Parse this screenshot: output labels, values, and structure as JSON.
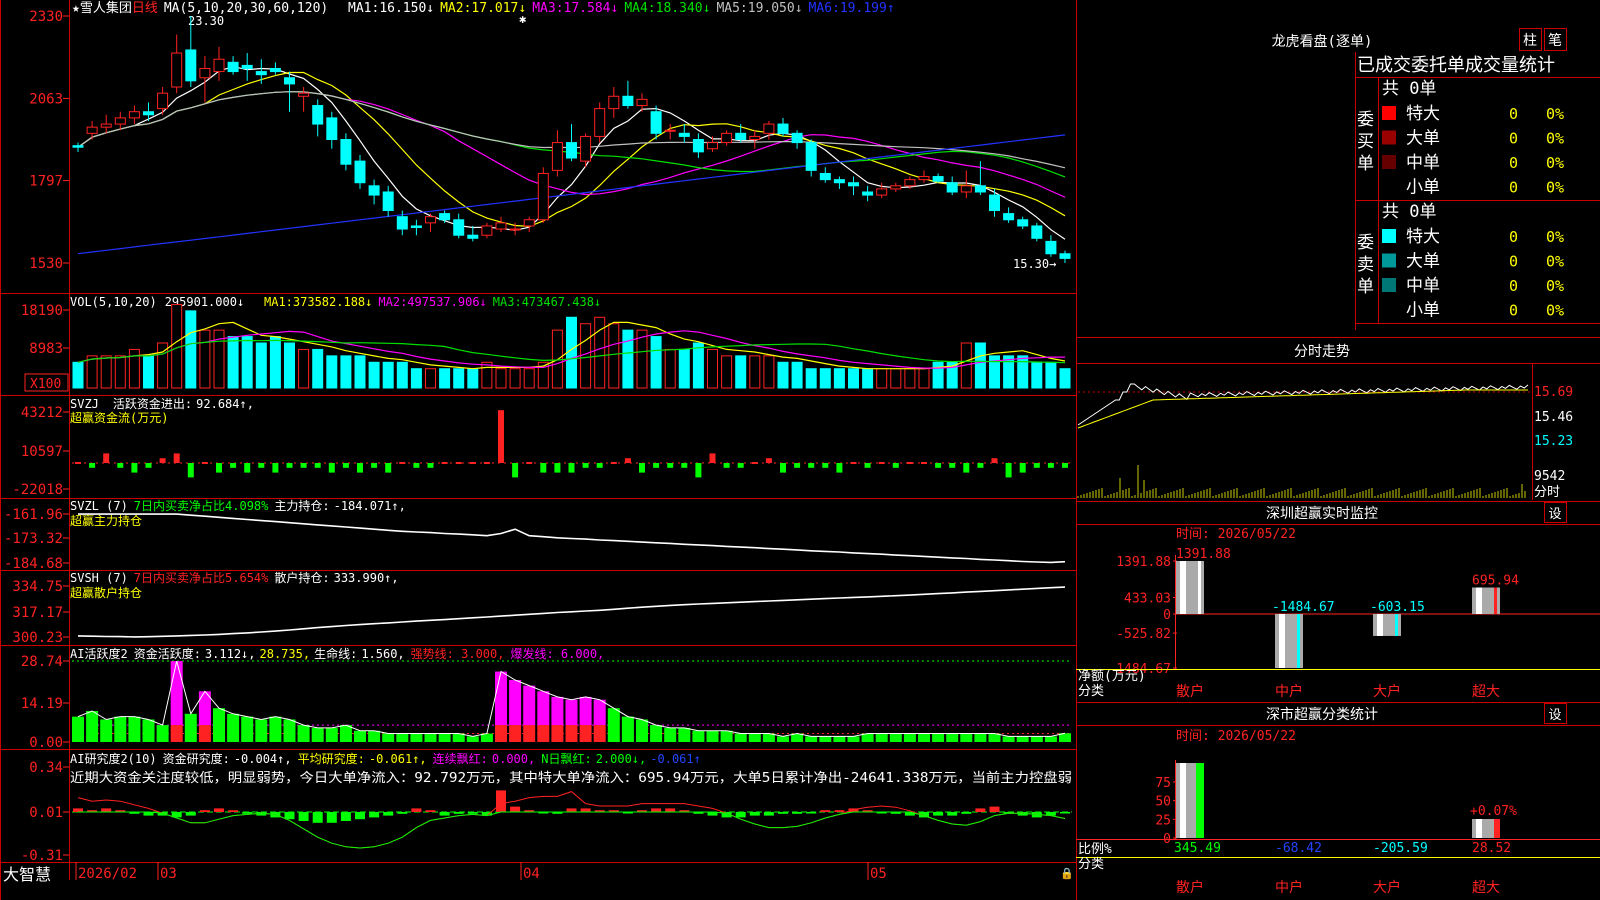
{
  "colors": {
    "up": "#ff2222",
    "down": "#00ffff",
    "grid": "#cc0000",
    "ma1": "#ffffff",
    "ma2": "#ffff00",
    "ma3": "#ff00ff",
    "ma4": "#00e000",
    "ma5": "#c0c0c0",
    "ma6": "#2233ff"
  },
  "main": {
    "stock_name": "雪人集团",
    "period": "日线",
    "ma_header": "MA(5,10,20,30,60,120)",
    "ma_items": [
      {
        "label": "MA1:",
        "value": "16.150↓",
        "color": "#ffffff"
      },
      {
        "label": "MA2:",
        "value": "17.017↓",
        "color": "#ffff00"
      },
      {
        "label": "MA3:",
        "value": "17.584↓",
        "color": "#ff00ff"
      },
      {
        "label": "MA4:",
        "value": "18.340↓",
        "color": "#00e000"
      },
      {
        "label": "MA5:",
        "value": "19.050↓",
        "color": "#c0c0c0"
      },
      {
        "label": "MA6:",
        "value": "19.199↑",
        "color": "#2233ff"
      }
    ],
    "y_ticks": [
      "2330",
      "2063",
      "1797",
      "1530"
    ],
    "high_label": "23.30",
    "low_label": "15.30→"
  },
  "vol": {
    "header": "VOL(5,10,20)",
    "value": "295901.000↓",
    "items": [
      {
        "label": "MA1:",
        "value": "373582.188↓",
        "color": "#ffff00"
      },
      {
        "label": "MA2:",
        "value": "497537.906↓",
        "color": "#ff00ff"
      },
      {
        "label": "MA3:",
        "value": "473467.438↓",
        "color": "#00e000"
      }
    ],
    "y_ticks": [
      "18190",
      "8983"
    ],
    "unit": "X100"
  },
  "svzj": {
    "header": "SVZJ",
    "line1": "活跃资金进出:",
    "value": "92.684↑,",
    "line2": "超赢资金流(万元)",
    "y_ticks": [
      "43212",
      "10597",
      "-22018"
    ]
  },
  "svzl": {
    "header": "SVZL (7)",
    "t1": "7日内买卖净占比4.098%",
    "t2": "主力持仓:",
    "value": "-184.071↑,",
    "line2": "超赢主力持仓",
    "y_ticks": [
      "-161.96",
      "-173.32",
      "-184.68"
    ]
  },
  "svsh": {
    "header": "SVSH (7)",
    "t1": "7日内买卖净占比5.654%",
    "t2": "散户持仓:",
    "value": "333.990↑,",
    "line2": "超赢散户持仓",
    "y_ticks": [
      "334.75",
      "317.17",
      "300.23"
    ]
  },
  "ai1": {
    "header": "AI活跃度2",
    "t1": "资金活跃度:",
    "v1": "3.112↓,",
    "v2": "28.735,",
    "t3": "生命线:",
    "v3": "1.560,",
    "t4": "强势线: 3.000,",
    "t5": "爆发线: 6.000,",
    "y_ticks": [
      "28.74",
      "14.19",
      "0.00"
    ]
  },
  "ai2": {
    "header": "AI研究度2(10)",
    "t1": "资金研究度:",
    "v1": "-0.004↑,",
    "t2": "平均研究度:",
    "v2": "-0.061↑,",
    "t3": "连续飘红:",
    "v3": "0.000,",
    "t4": "N日飘红:",
    "v4": "2.000↓,",
    "v5": "-0.061↑",
    "comment": "近期大资金关注度较低，明显弱势，今日大单净流入：92.792万元，其中特大单净流入：695.94万元，大单5日累计净出-24641.338万元，当前主力控盘弱",
    "y_ticks": [
      "0.34",
      "0.01",
      "-0.31"
    ]
  },
  "x_axis": {
    "labels": [
      "2026/02",
      "03",
      "04",
      "05"
    ],
    "brand": "大智慧"
  },
  "dragon": {
    "title": "龙虎看盘(逐单)",
    "btn1": "柱",
    "btn2": "笔",
    "subtitle": "已成交委托单成交量统计",
    "buy": {
      "label": "委买单",
      "total": "共 0单",
      "rows": [
        {
          "name": "特大",
          "val": "0",
          "pct": "0%",
          "color": "#ff0000"
        },
        {
          "name": "大单",
          "val": "0",
          "pct": "0%",
          "color": "#990000"
        },
        {
          "name": "中单",
          "val": "0",
          "pct": "0%",
          "color": "#660000"
        },
        {
          "name": "小单",
          "val": "0",
          "pct": "0%",
          "color": "#000000"
        }
      ]
    },
    "sell": {
      "label": "委卖单",
      "total": "共 0单",
      "rows": [
        {
          "name": "特大",
          "val": "0",
          "pct": "0%",
          "color": "#00ffff"
        },
        {
          "name": "大单",
          "val": "0",
          "pct": "0%",
          "color": "#009999"
        },
        {
          "name": "中单",
          "val": "0",
          "pct": "0%",
          "color": "#007777"
        },
        {
          "name": "小单",
          "val": "0",
          "pct": "0%",
          "color": "#000000"
        }
      ]
    }
  },
  "intraday": {
    "title": "分时走势",
    "price_ticks": [
      "15.69",
      "15.46",
      "15.23"
    ],
    "vol_tick": "9542",
    "unit": "分时"
  },
  "monitor": {
    "title": "深圳超赢实时监控",
    "btn": "设",
    "time": "时间: 2026/05/22",
    "y_ticks": [
      "1391.88",
      "433.03",
      "0",
      "-525.82",
      "-1484.67"
    ],
    "ylabel1": "净额(万元)",
    "ylabel2": "分类",
    "categories": [
      "散户",
      "中户",
      "大户",
      "超大"
    ],
    "values": [
      1391.88,
      -1484.67,
      -603.15,
      695.94
    ],
    "value_labels": [
      "1391.88",
      "-1484.67",
      "-603.15",
      "695.94"
    ]
  },
  "classify": {
    "title": "深市超赢分类统计",
    "btn": "设",
    "time": "时间: 2026/05/22",
    "y_ticks": [
      "75",
      "50",
      "25",
      "0"
    ],
    "ylabel1": "比例%",
    "ylabel2": "分类",
    "pct_label": "+0.07%",
    "categories": [
      "散户",
      "中户",
      "大户",
      "超大"
    ],
    "values": [
      345.49,
      -68.42,
      -205.59,
      28.52
    ],
    "value_labels": [
      "345.49",
      "-68.42",
      "-205.59",
      "28.52"
    ]
  },
  "chart_data": [
    {
      "type": "candlestick",
      "title": "雪人集团 日线",
      "ylim": [
        15.3,
        23.3
      ],
      "candles": [
        [
          19.1,
          19.2,
          18.9,
          19.05
        ],
        [
          19.5,
          19.9,
          19.3,
          19.7
        ],
        [
          19.7,
          20.1,
          19.5,
          19.8
        ],
        [
          19.8,
          20.2,
          19.6,
          20.0
        ],
        [
          20.0,
          20.4,
          19.8,
          20.2
        ],
        [
          20.2,
          20.5,
          19.9,
          20.1
        ],
        [
          20.3,
          21.0,
          20.1,
          20.8
        ],
        [
          21.0,
          22.7,
          20.8,
          22.1
        ],
        [
          22.2,
          23.3,
          21.0,
          21.2
        ],
        [
          21.3,
          22.0,
          20.5,
          21.6
        ],
        [
          21.5,
          22.3,
          21.2,
          21.9
        ],
        [
          21.8,
          22.0,
          21.4,
          21.5
        ],
        [
          21.7,
          22.1,
          21.2,
          21.6
        ],
        [
          21.5,
          21.9,
          21.1,
          21.4
        ],
        [
          21.6,
          21.8,
          21.4,
          21.5
        ],
        [
          21.3,
          21.5,
          20.2,
          21.1
        ],
        [
          20.7,
          21.0,
          20.2,
          20.8
        ],
        [
          20.4,
          20.6,
          19.4,
          19.8
        ],
        [
          20.0,
          20.2,
          19.0,
          19.3
        ],
        [
          19.3,
          19.5,
          18.3,
          18.5
        ],
        [
          18.6,
          18.8,
          17.7,
          17.9
        ],
        [
          17.8,
          18.0,
          17.2,
          17.5
        ],
        [
          17.6,
          17.8,
          16.8,
          17.0
        ],
        [
          16.8,
          17.0,
          16.2,
          16.4
        ],
        [
          16.5,
          16.7,
          16.2,
          16.45
        ],
        [
          16.6,
          16.9,
          16.3,
          16.8
        ],
        [
          16.9,
          17.0,
          16.6,
          16.7
        ],
        [
          16.7,
          16.9,
          16.1,
          16.2
        ],
        [
          16.2,
          16.5,
          16.0,
          16.1
        ],
        [
          16.2,
          16.6,
          16.1,
          16.5
        ],
        [
          16.4,
          16.8,
          16.3,
          16.6
        ],
        [
          16.4,
          16.6,
          16.2,
          16.4
        ],
        [
          16.5,
          16.8,
          16.3,
          16.7
        ],
        [
          16.7,
          18.4,
          16.6,
          18.2
        ],
        [
          18.3,
          19.6,
          18.1,
          19.2
        ],
        [
          19.2,
          19.8,
          18.6,
          18.7
        ],
        [
          18.6,
          19.5,
          18.4,
          19.4
        ],
        [
          19.4,
          20.5,
          19.2,
          20.3
        ],
        [
          20.3,
          21.0,
          20.0,
          20.7
        ],
        [
          20.7,
          21.2,
          20.3,
          20.4
        ],
        [
          20.4,
          20.8,
          20.2,
          20.6
        ],
        [
          20.2,
          20.4,
          19.3,
          19.5
        ],
        [
          19.6,
          19.8,
          19.3,
          19.6
        ],
        [
          19.5,
          19.8,
          19.2,
          19.4
        ],
        [
          19.3,
          19.5,
          18.7,
          18.9
        ],
        [
          19.0,
          19.4,
          18.9,
          19.2
        ],
        [
          19.2,
          19.6,
          19.1,
          19.5
        ],
        [
          19.5,
          19.8,
          19.2,
          19.3
        ],
        [
          19.3,
          19.6,
          19.0,
          19.4
        ],
        [
          19.5,
          19.9,
          19.3,
          19.8
        ],
        [
          19.8,
          20.0,
          19.4,
          19.5
        ],
        [
          19.5,
          19.6,
          19.0,
          19.2
        ],
        [
          19.2,
          19.3,
          18.1,
          18.3
        ],
        [
          18.2,
          18.4,
          17.9,
          18.0
        ],
        [
          18.0,
          18.1,
          17.7,
          17.9
        ],
        [
          17.9,
          18.1,
          17.5,
          17.8
        ],
        [
          17.6,
          17.8,
          17.3,
          17.5
        ],
        [
          17.5,
          17.9,
          17.4,
          17.7
        ],
        [
          17.7,
          17.9,
          17.6,
          17.8
        ],
        [
          17.8,
          18.1,
          17.7,
          18.0
        ],
        [
          18.0,
          18.3,
          17.9,
          18.1
        ],
        [
          18.1,
          18.2,
          17.9,
          17.95
        ],
        [
          17.9,
          18.1,
          17.5,
          17.6
        ],
        [
          17.6,
          18.3,
          17.4,
          17.8
        ],
        [
          17.8,
          18.6,
          17.5,
          17.6
        ],
        [
          17.5,
          17.7,
          16.8,
          17.0
        ],
        [
          16.9,
          17.1,
          16.6,
          16.7
        ],
        [
          16.7,
          16.8,
          16.4,
          16.5
        ],
        [
          16.5,
          16.6,
          16.0,
          16.1
        ],
        [
          16.0,
          16.2,
          15.5,
          15.6
        ],
        [
          15.6,
          15.7,
          15.3,
          15.45
        ]
      ]
    },
    {
      "type": "bar",
      "title": "VOL(5,10,20)",
      "values": [
        4,
        5,
        5,
        5,
        6,
        5,
        7,
        13,
        12,
        9,
        9,
        8,
        8,
        7,
        8,
        7,
        6,
        6,
        5,
        5,
        5,
        4,
        4,
        4,
        3,
        3,
        3,
        3,
        3,
        4,
        3,
        3,
        3,
        4,
        9,
        11,
        10,
        11,
        10,
        9,
        9,
        8,
        6,
        6,
        7,
        6,
        5,
        5,
        5,
        5,
        4,
        4,
        3,
        3,
        3,
        3,
        3,
        3,
        3,
        3,
        3,
        4,
        4,
        7,
        7,
        5,
        5,
        5,
        4,
        4,
        3
      ]
    },
    {
      "type": "bar",
      "title": "超赢资金流(万元)",
      "values": [
        0,
        -1,
        2,
        -1,
        -2,
        -1,
        1,
        2,
        -3,
        0,
        -2,
        -1,
        -2,
        -1,
        -2,
        -1,
        -1,
        -1,
        -2,
        -1,
        -2,
        -1,
        -2,
        0,
        -1,
        -1,
        0,
        0,
        0,
        0,
        11,
        -3,
        0,
        -2,
        -2,
        -2,
        -1,
        -1,
        0,
        1,
        -2,
        -1,
        -1,
        -1,
        -3,
        2,
        -1,
        -1,
        0,
        1,
        -2,
        -1,
        -1,
        -1,
        -2,
        0,
        -1,
        0,
        -1,
        0,
        0,
        -1,
        -1,
        -2,
        -1,
        1,
        -3,
        -2,
        -1,
        -1,
        -1
      ]
    },
    {
      "type": "line",
      "title": "超赢主力持仓",
      "values": [
        -162,
        -162,
        -162,
        -162,
        -162,
        -162,
        -162,
        -162,
        -162.5,
        -163,
        -163.5,
        -164,
        -164.5,
        -165,
        -165.5,
        -166,
        -166.5,
        -167,
        -167.5,
        -168,
        -168.5,
        -169,
        -169.5,
        -170,
        -170.3,
        -170.6,
        -171,
        -171.3,
        -171.6,
        -172,
        -171,
        -169,
        -172,
        -172.5,
        -173,
        -173.3,
        -173.6,
        -174,
        -174.3,
        -174.6,
        -175,
        -175.3,
        -175.6,
        -176,
        -176.3,
        -176.6,
        -177,
        -177.3,
        -177.6,
        -178,
        -178.3,
        -178.6,
        -179,
        -179.3,
        -179.6,
        -180,
        -180.3,
        -180.6,
        -181,
        -181.3,
        -181.6,
        -182,
        -182.3,
        -182.6,
        -183,
        -183.3,
        -183.6,
        -184,
        -184.2,
        -184.4,
        -184.07
      ]
    },
    {
      "type": "line",
      "title": "超赢散户持仓",
      "values": [
        301,
        300.8,
        300.6,
        300.5,
        300.3,
        300.4,
        300.7,
        301,
        301.3,
        301.6,
        302,
        302.5,
        303,
        303.6,
        304.2,
        305,
        305.8,
        306.6,
        307.3,
        308,
        308.6,
        309.2,
        309.8,
        310.4,
        311,
        311.5,
        312,
        312.6,
        313.2,
        313.8,
        314.4,
        315,
        315.6,
        316.2,
        316.8,
        317.3,
        317.8,
        318.3,
        319,
        319.7,
        320.4,
        321,
        321.6,
        322.1,
        322.6,
        323,
        323.4,
        323.8,
        324.2,
        324.6,
        325,
        325.4,
        325.8,
        326.2,
        326.6,
        327,
        327.4,
        327.8,
        328.2,
        328.6,
        329.1,
        329.6,
        330.1,
        330.6,
        331.1,
        331.6,
        332.1,
        332.6,
        333.1,
        333.6,
        333.99
      ]
    },
    {
      "type": "bar",
      "title": "AI活跃度2",
      "values": [
        9,
        11,
        8,
        9,
        9,
        8,
        6,
        28.7,
        10,
        18,
        12,
        10,
        9,
        8,
        9,
        8,
        6,
        5,
        5,
        6,
        4,
        4,
        3,
        3,
        3,
        3,
        3,
        3,
        2,
        3,
        25,
        22,
        20,
        18,
        16,
        15,
        16,
        15,
        12,
        9,
        8,
        6,
        5,
        5,
        4,
        4,
        4,
        3,
        3,
        3,
        2,
        3,
        2,
        2,
        2,
        2,
        3,
        3,
        3,
        3,
        3,
        3,
        3,
        3,
        3,
        3,
        2,
        2,
        2,
        2,
        3.1
      ]
    },
    {
      "type": "bar",
      "title": "AI研究度2(10)",
      "values": [
        0.02,
        0.01,
        0.02,
        0.01,
        -0.01,
        -0.02,
        -0.02,
        -0.03,
        -0.02,
        0.01,
        0.02,
        0.01,
        -0.01,
        -0.02,
        -0.03,
        -0.04,
        -0.05,
        -0.06,
        -0.06,
        -0.05,
        -0.04,
        -0.03,
        -0.02,
        -0.01,
        0.02,
        0.01,
        -0.02,
        -0.01,
        -0.01,
        -0.02,
        0.12,
        0.03,
        0.01,
        0.0,
        -0.01,
        0.02,
        0.02,
        0.01,
        0.01,
        0.0,
        0.01,
        0.02,
        0.02,
        0.01,
        -0.01,
        -0.02,
        -0.03,
        -0.03,
        -0.02,
        -0.02,
        -0.01,
        -0.01,
        0.0,
        0.01,
        0.01,
        0.02,
        0.01,
        0.0,
        -0.01,
        -0.02,
        -0.03,
        -0.02,
        -0.02,
        -0.01,
        0.02,
        0.03,
        -0.01,
        -0.02,
        -0.03,
        -0.02,
        -0.004
      ]
    }
  ]
}
